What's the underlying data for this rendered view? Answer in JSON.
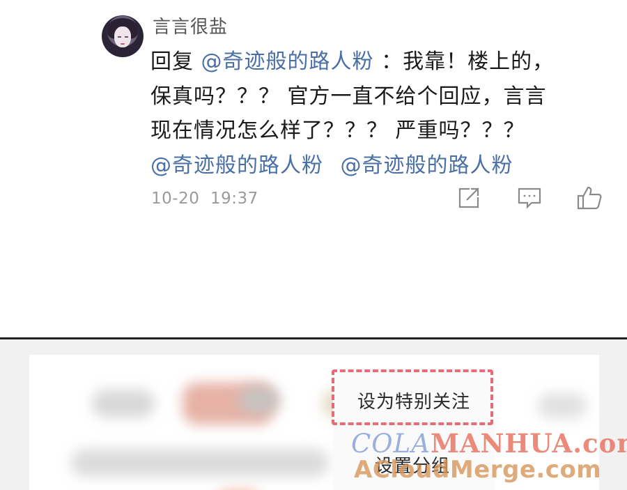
{
  "comment": {
    "username": "言言很盐",
    "reply_prefix": "回复",
    "mention_1": "@奇迹般的路人粉",
    "text_1": "：我靠！楼上的，",
    "text_2": "保真吗？？？ 官方一直不给个回应，言言",
    "text_3": "现在情况怎么样了？？？ 严重吗？？？",
    "mention_2": "@奇迹般的路人粉",
    "mention_3": "@奇迹般的路人粉",
    "timestamp": "10-20  19:37",
    "actions": [
      "share-icon",
      "comment-icon",
      "like-icon"
    ]
  },
  "context_menu": {
    "item_1": "设为特别关注",
    "item_2": "设置分组",
    "highlight_color": "#e56d78"
  },
  "watermark": {
    "line_1_prefix": "COLA",
    "line_1_rest": "MANHUA.com",
    "line_2": "ACloudMerge.com"
  },
  "colors": {
    "mention": "#4a6fa5",
    "meta": "#9a9a9a"
  }
}
